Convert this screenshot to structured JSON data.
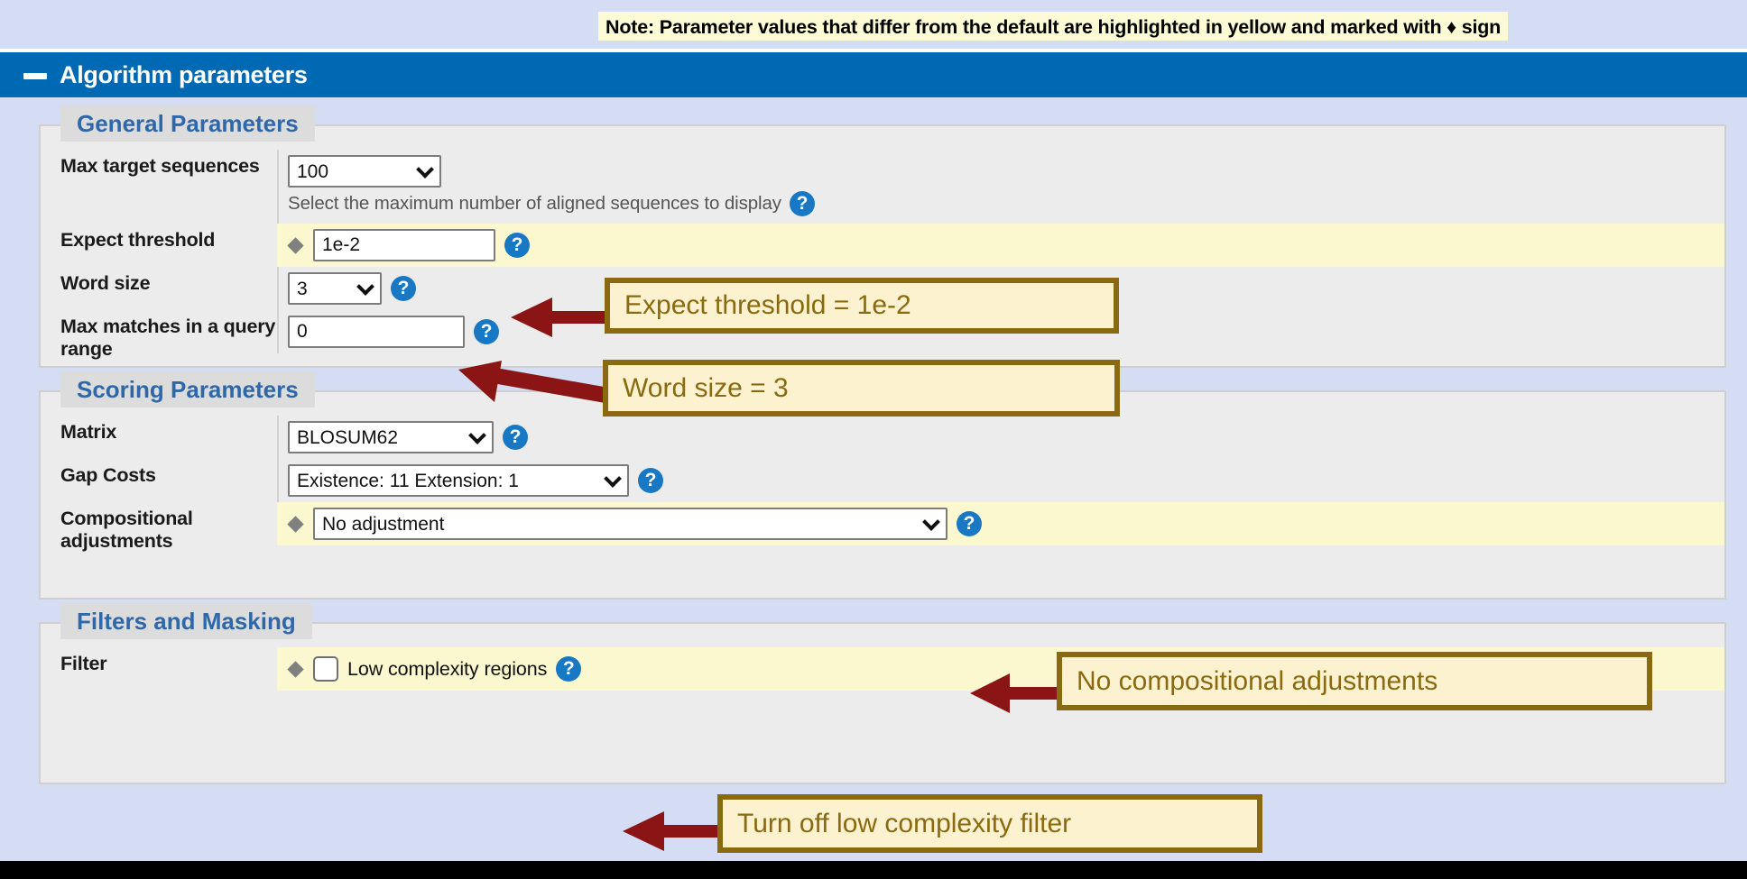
{
  "note": {
    "text": "Note: Parameter values that differ from the default are highlighted in yellow and marked with ♦ sign"
  },
  "titlebar": {
    "collapse_icon": "minus-icon",
    "title": "Algorithm parameters"
  },
  "sections": [
    {
      "legend": "General Parameters",
      "rows": [
        {
          "label": "Max target sequences",
          "control": "select",
          "value": "100",
          "highlighted": false,
          "modified": false,
          "help": true,
          "helptext": "Select the maximum number of aligned sequences to display"
        },
        {
          "label": "Expect threshold",
          "control": "text",
          "value": "1e-2",
          "highlighted": true,
          "modified": true,
          "help": true
        },
        {
          "label": "Word size",
          "control": "select",
          "value": "3",
          "highlighted": false,
          "modified": false,
          "help": true
        },
        {
          "label": "Max matches in a query range",
          "control": "text",
          "value": "0",
          "highlighted": false,
          "modified": false,
          "help": true
        }
      ]
    },
    {
      "legend": "Scoring Parameters",
      "rows": [
        {
          "label": "Matrix",
          "control": "select",
          "value": "BLOSUM62",
          "highlighted": false,
          "modified": false,
          "help": true
        },
        {
          "label": "Gap Costs",
          "control": "select",
          "value": "Existence: 11 Extension: 1",
          "highlighted": false,
          "modified": false,
          "help": true
        },
        {
          "label": "Compositional adjustments",
          "control": "select",
          "value": "No adjustment",
          "highlighted": true,
          "modified": true,
          "help": true
        }
      ]
    },
    {
      "legend": "Filters and Masking",
      "rows": [
        {
          "label": "Filter",
          "control": "checkbox",
          "value": "Low complexity regions",
          "checked": false,
          "highlighted": true,
          "modified": true,
          "help": true
        }
      ]
    }
  ],
  "callouts": [
    {
      "text": "Expect threshold = 1e-2"
    },
    {
      "text": "Word size = 3"
    },
    {
      "text": "No compositional adjustments"
    },
    {
      "text": "Turn off low complexity filter"
    }
  ],
  "colors": {
    "accent_blue": "#0069b4",
    "panel_blue": "#d4ddf4",
    "panel_gray": "#ececec",
    "highlight_yellow": "#fbf8cf",
    "callout_border": "#8a6a10",
    "callout_fill": "#fcf2cf",
    "arrow_red": "#8b1515",
    "legend_text": "#2f68aa"
  }
}
